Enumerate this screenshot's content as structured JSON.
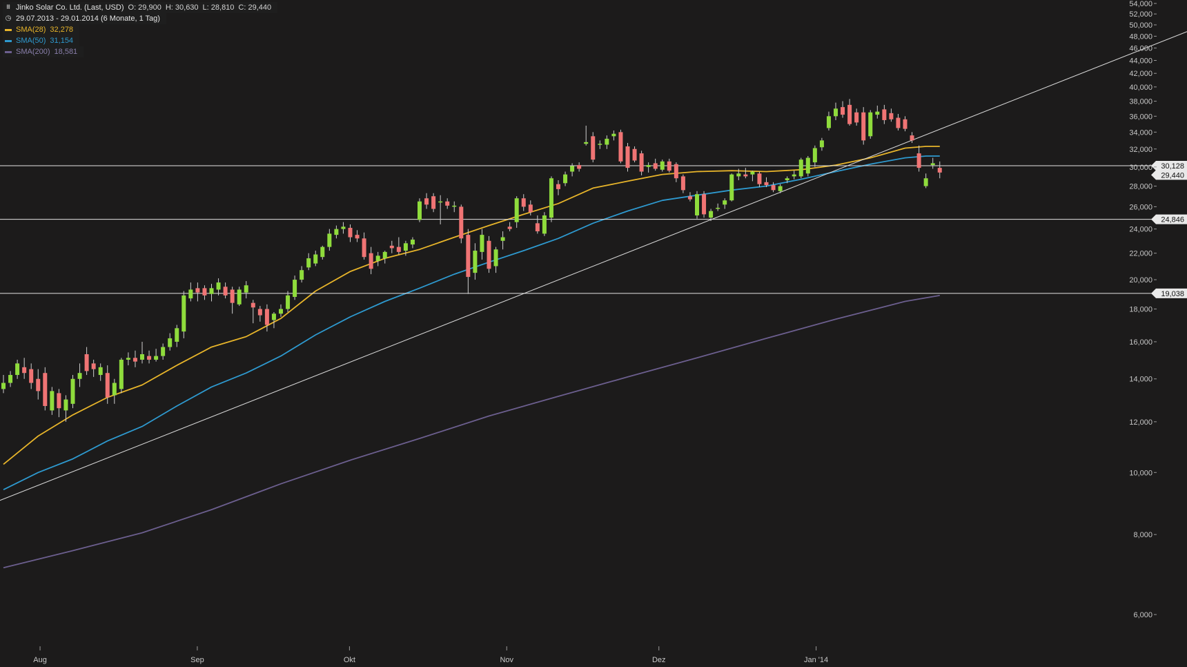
{
  "header": {
    "title": "Jinko Solar Co. Ltd. (Last, USD)",
    "open": "O: 29,900",
    "high": "H: 30,630",
    "low": "L: 28,810",
    "close": "C: 29,440",
    "period": "29.07.2013 - 29.01.2014 (6 Monate, 1 Tag)"
  },
  "indicators": [
    {
      "name": "SMA(28)",
      "value": "32,278",
      "color": "#e8b52a"
    },
    {
      "name": "SMA(50)",
      "value": "31,154",
      "color": "#2e9ad0"
    },
    {
      "name": "SMA(200)",
      "value": "18,581",
      "color": "#6c5f8f"
    }
  ],
  "colors": {
    "up": "#8fdc3c",
    "down": "#f07474",
    "background": "#1c1b1b",
    "axis_text": "#c8c8c8"
  },
  "chart_data": {
    "type": "candlestick",
    "scale": "log",
    "ylim": [
      5.3,
      54
    ],
    "yticks": [
      "6,000",
      "8,000",
      "10,000",
      "12,000",
      "14,000",
      "16,000",
      "18,000",
      "20,000",
      "22,000",
      "24,000",
      "26,000",
      "28,000",
      "30,000",
      "32,000",
      "34,000",
      "36,000",
      "38,000",
      "40,000",
      "42,000",
      "44,000",
      "46,000",
      "48,000",
      "50,000",
      "52,000",
      "54,000"
    ],
    "xticks": [
      "Aug",
      "Sep",
      "Okt",
      "Nov",
      "Dez",
      "Jan '14"
    ],
    "xtick_days": [
      3,
      34,
      64,
      95,
      125,
      156
    ],
    "candles": [
      [
        0,
        13.5,
        14.2,
        13.3,
        13.8
      ],
      [
        1,
        13.8,
        14.4,
        13.6,
        14.2
      ],
      [
        2,
        14.2,
        15.0,
        14.0,
        14.8
      ],
      [
        3,
        14.6,
        15.1,
        14.0,
        14.3
      ],
      [
        4,
        14.5,
        14.8,
        13.5,
        13.8
      ],
      [
        5,
        14.0,
        14.5,
        13.0,
        13.4
      ],
      [
        6,
        14.3,
        14.6,
        12.5,
        12.7
      ],
      [
        7,
        12.5,
        13.6,
        12.3,
        13.4
      ],
      [
        8,
        13.3,
        13.5,
        12.2,
        12.6
      ],
      [
        9,
        12.5,
        13.2,
        12.0,
        13.0
      ],
      [
        10,
        12.8,
        14.2,
        12.6,
        14.0
      ],
      [
        11,
        14.0,
        14.8,
        13.6,
        14.3
      ],
      [
        12,
        15.3,
        15.7,
        14.2,
        14.4
      ],
      [
        13,
        14.8,
        15.0,
        14.1,
        14.5
      ],
      [
        14,
        14.2,
        14.8,
        13.9,
        14.6
      ],
      [
        15,
        14.3,
        14.7,
        12.8,
        13.1
      ],
      [
        16,
        13.2,
        14.0,
        12.8,
        13.8
      ],
      [
        17,
        13.5,
        15.1,
        13.3,
        15.0
      ],
      [
        18,
        15.0,
        15.4,
        14.7,
        15.1
      ],
      [
        19,
        15.1,
        15.5,
        14.6,
        14.9
      ],
      [
        20,
        15.0,
        16.0,
        14.8,
        15.3
      ],
      [
        21,
        15.2,
        15.5,
        14.8,
        15.0
      ],
      [
        22,
        15.0,
        15.6,
        14.9,
        15.2
      ],
      [
        23,
        15.2,
        15.9,
        15.0,
        15.7
      ],
      [
        24,
        15.7,
        16.5,
        15.5,
        16.2
      ],
      [
        25,
        16.0,
        17.0,
        15.7,
        16.8
      ],
      [
        26,
        16.6,
        19.2,
        16.2,
        18.9
      ],
      [
        27,
        18.7,
        19.8,
        18.5,
        19.3
      ],
      [
        28,
        19.4,
        19.8,
        18.5,
        19.1
      ],
      [
        29,
        19.4,
        19.6,
        18.6,
        18.9
      ],
      [
        30,
        19.0,
        19.7,
        18.5,
        19.4
      ],
      [
        31,
        19.3,
        20.1,
        18.9,
        19.8
      ],
      [
        32,
        19.5,
        19.8,
        18.7,
        18.9
      ],
      [
        33,
        19.3,
        19.5,
        17.7,
        18.4
      ],
      [
        34,
        18.3,
        19.5,
        18.2,
        19.3
      ],
      [
        35,
        19.1,
        19.9,
        18.7,
        19.6
      ],
      [
        36,
        18.4,
        18.6,
        17.1,
        18.1
      ],
      [
        37,
        18.0,
        18.2,
        17.2,
        17.6
      ],
      [
        38,
        18.0,
        18.3,
        16.6,
        17.0
      ],
      [
        39,
        17.3,
        17.8,
        16.8,
        17.7
      ],
      [
        40,
        17.7,
        18.3,
        17.5,
        18.0
      ],
      [
        41,
        18.0,
        19.2,
        17.8,
        18.9
      ],
      [
        42,
        18.8,
        20.3,
        18.6,
        20.0
      ],
      [
        43,
        20.0,
        21.0,
        19.8,
        20.7
      ],
      [
        44,
        20.9,
        22.0,
        20.7,
        21.6
      ],
      [
        45,
        21.2,
        22.2,
        21.0,
        21.9
      ],
      [
        46,
        21.7,
        22.6,
        21.5,
        22.5
      ],
      [
        47,
        22.5,
        24.0,
        22.2,
        23.6
      ],
      [
        48,
        23.5,
        24.3,
        23.2,
        24.0
      ],
      [
        49,
        24.0,
        24.6,
        23.6,
        24.2
      ],
      [
        50,
        24.1,
        24.4,
        22.9,
        23.3
      ],
      [
        51,
        23.5,
        23.9,
        22.9,
        23.2
      ],
      [
        52,
        23.2,
        23.7,
        21.5,
        21.7
      ],
      [
        53,
        22.0,
        22.5,
        20.4,
        20.8
      ],
      [
        54,
        21.4,
        22.1,
        21.0,
        21.8
      ],
      [
        55,
        21.6,
        22.2,
        21.2,
        22.1
      ],
      [
        56,
        22.6,
        23.0,
        22.0,
        22.4
      ],
      [
        57,
        22.5,
        23.3,
        21.9,
        22.1
      ],
      [
        58,
        22.2,
        23.0,
        21.8,
        22.8
      ],
      [
        59,
        22.7,
        23.3,
        22.4,
        23.1
      ],
      [
        60,
        24.8,
        26.8,
        24.6,
        26.5
      ],
      [
        61,
        26.8,
        27.3,
        25.8,
        26.2
      ],
      [
        62,
        27.0,
        27.3,
        25.5,
        25.8
      ],
      [
        63,
        26.5,
        27.1,
        24.4,
        26.5
      ],
      [
        64,
        26.5,
        26.8,
        25.8,
        26.1
      ],
      [
        65,
        26.0,
        26.5,
        25.5,
        26.1
      ],
      [
        66,
        26.0,
        26.2,
        22.8,
        23.2
      ],
      [
        67,
        23.5,
        24.0,
        19.0,
        20.2
      ],
      [
        68,
        20.5,
        22.8,
        20.0,
        22.2
      ],
      [
        69,
        22.1,
        24.0,
        21.5,
        23.5
      ],
      [
        70,
        23.0,
        23.4,
        20.5,
        20.8
      ],
      [
        71,
        21.0,
        22.5,
        20.5,
        22.3
      ],
      [
        72,
        23.0,
        23.8,
        22.3,
        23.3
      ],
      [
        73,
        24.2,
        24.6,
        23.8,
        24.0
      ],
      [
        74,
        24.6,
        27.0,
        24.1,
        26.8
      ],
      [
        75,
        26.8,
        27.2,
        25.6,
        26.0
      ],
      [
        76,
        26.2,
        26.6,
        25.2,
        25.5
      ],
      [
        77,
        24.5,
        25.2,
        23.6,
        23.8
      ],
      [
        78,
        23.6,
        25.5,
        23.4,
        25.2
      ],
      [
        79,
        25.0,
        29.0,
        24.6,
        28.8
      ],
      [
        80,
        28.2,
        28.6,
        27.1,
        27.7
      ],
      [
        81,
        28.3,
        29.5,
        28.0,
        29.2
      ],
      [
        82,
        29.5,
        30.4,
        29.0,
        30.1
      ],
      [
        83,
        30.2,
        30.5,
        29.5,
        29.8
      ],
      [
        84,
        32.6,
        34.8,
        32.4,
        32.8
      ],
      [
        85,
        33.5,
        34.0,
        30.5,
        30.8
      ],
      [
        86,
        32.5,
        33.0,
        32.0,
        32.6
      ],
      [
        87,
        32.5,
        33.6,
        32.0,
        33.2
      ],
      [
        88,
        33.5,
        34.2,
        33.0,
        33.8
      ],
      [
        89,
        34.0,
        34.3,
        30.4,
        30.6
      ],
      [
        90,
        32.3,
        32.7,
        29.5,
        29.9
      ],
      [
        91,
        32.0,
        32.3,
        30.5,
        30.7
      ],
      [
        92,
        31.5,
        31.8,
        29.1,
        29.5
      ],
      [
        93,
        30.0,
        30.5,
        29.4,
        30.2
      ],
      [
        94,
        30.4,
        30.9,
        29.6,
        29.8
      ],
      [
        95,
        29.7,
        30.8,
        29.5,
        30.6
      ],
      [
        96,
        30.6,
        30.9,
        29.4,
        29.6
      ],
      [
        97,
        30.3,
        30.5,
        28.4,
        28.8
      ],
      [
        98,
        29.0,
        29.2,
        27.3,
        27.6
      ],
      [
        99,
        27.0,
        27.4,
        26.5,
        26.7
      ],
      [
        100,
        25.2,
        27.5,
        24.9,
        27.2
      ],
      [
        101,
        27.2,
        27.5,
        25.0,
        25.3
      ],
      [
        102,
        25.0,
        25.8,
        24.7,
        25.6
      ],
      [
        103,
        25.9,
        26.3,
        25.6,
        25.9
      ],
      [
        104,
        26.2,
        26.8,
        25.8,
        26.6
      ],
      [
        105,
        26.6,
        29.3,
        26.5,
        29.2
      ],
      [
        106,
        29.0,
        29.8,
        28.6,
        29.3
      ],
      [
        107,
        29.2,
        29.9,
        28.8,
        29.0
      ],
      [
        108,
        29.2,
        29.6,
        28.5,
        29.5
      ],
      [
        109,
        29.3,
        29.5,
        27.9,
        28.2
      ],
      [
        110,
        28.4,
        28.9,
        27.9,
        28.1
      ],
      [
        111,
        28.1,
        28.4,
        27.4,
        27.6
      ],
      [
        112,
        27.5,
        28.2,
        27.3,
        28.0
      ],
      [
        113,
        28.6,
        29.0,
        28.3,
        28.8
      ],
      [
        114,
        29.0,
        29.6,
        28.7,
        29.2
      ],
      [
        115,
        29.0,
        31.0,
        28.8,
        30.8
      ],
      [
        116,
        29.3,
        31.2,
        29.0,
        31.0
      ],
      [
        117,
        30.5,
        32.4,
        30.0,
        32.1
      ],
      [
        118,
        32.2,
        33.3,
        31.8,
        33.0
      ],
      [
        119,
        34.5,
        36.6,
        34.2,
        36.0
      ],
      [
        120,
        36.0,
        37.8,
        35.5,
        37.0
      ],
      [
        121,
        37.2,
        38.0,
        35.8,
        36.2
      ],
      [
        122,
        37.5,
        38.3,
        34.8,
        35.0
      ],
      [
        123,
        36.5,
        37.0,
        34.8,
        35.2
      ],
      [
        124,
        36.5,
        37.2,
        32.5,
        33.0
      ],
      [
        125,
        33.5,
        36.8,
        33.2,
        36.5
      ],
      [
        126,
        36.2,
        37.4,
        35.7,
        36.6
      ],
      [
        127,
        36.9,
        37.5,
        35.0,
        35.5
      ],
      [
        128,
        36.4,
        37.0,
        35.3,
        35.6
      ],
      [
        129,
        35.8,
        36.3,
        34.2,
        34.5
      ],
      [
        130,
        35.6,
        36.0,
        34.1,
        34.4
      ],
      [
        131,
        33.6,
        34.0,
        32.7,
        33.0
      ],
      [
        132,
        31.5,
        32.4,
        29.5,
        29.9
      ],
      [
        133,
        28.0,
        29.3,
        27.8,
        28.8
      ],
      [
        134,
        30.2,
        31.0,
        29.8,
        30.4
      ],
      [
        135,
        29.9,
        30.6,
        28.8,
        29.4
      ]
    ],
    "sma": [
      {
        "name": "SMA(28)",
        "color": "#e8b52a",
        "points": [
          [
            0,
            10.3
          ],
          [
            5,
            11.4
          ],
          [
            10,
            12.3
          ],
          [
            15,
            13.1
          ],
          [
            20,
            13.7
          ],
          [
            25,
            14.7
          ],
          [
            30,
            15.7
          ],
          [
            35,
            16.3
          ],
          [
            40,
            17.4
          ],
          [
            45,
            19.2
          ],
          [
            50,
            20.6
          ],
          [
            55,
            21.6
          ],
          [
            60,
            22.3
          ],
          [
            65,
            23.3
          ],
          [
            70,
            24.3
          ],
          [
            75,
            25.3
          ],
          [
            80,
            26.3
          ],
          [
            85,
            27.8
          ],
          [
            90,
            28.5
          ],
          [
            95,
            29.2
          ],
          [
            100,
            29.5
          ],
          [
            105,
            29.6
          ],
          [
            110,
            29.5
          ],
          [
            115,
            29.7
          ],
          [
            120,
            30.2
          ],
          [
            125,
            31.0
          ],
          [
            130,
            32.1
          ],
          [
            133,
            32.3
          ],
          [
            135,
            32.3
          ]
        ]
      },
      {
        "name": "SMA(50)",
        "color": "#2e9ad0",
        "points": [
          [
            0,
            9.4
          ],
          [
            5,
            10.0
          ],
          [
            10,
            10.5
          ],
          [
            15,
            11.2
          ],
          [
            20,
            11.8
          ],
          [
            25,
            12.7
          ],
          [
            30,
            13.6
          ],
          [
            35,
            14.3
          ],
          [
            40,
            15.2
          ],
          [
            45,
            16.4
          ],
          [
            50,
            17.5
          ],
          [
            55,
            18.5
          ],
          [
            60,
            19.4
          ],
          [
            65,
            20.4
          ],
          [
            70,
            21.3
          ],
          [
            75,
            22.2
          ],
          [
            80,
            23.2
          ],
          [
            85,
            24.5
          ],
          [
            90,
            25.6
          ],
          [
            95,
            26.6
          ],
          [
            100,
            27.1
          ],
          [
            105,
            27.6
          ],
          [
            110,
            28.0
          ],
          [
            115,
            28.7
          ],
          [
            120,
            29.5
          ],
          [
            125,
            30.3
          ],
          [
            130,
            31.0
          ],
          [
            133,
            31.2
          ],
          [
            135,
            31.2
          ]
        ]
      },
      {
        "name": "SMA(200)",
        "color": "#6c5f8f",
        "points": [
          [
            0,
            7.1
          ],
          [
            10,
            7.55
          ],
          [
            20,
            8.05
          ],
          [
            30,
            8.75
          ],
          [
            40,
            9.6
          ],
          [
            50,
            10.45
          ],
          [
            60,
            11.3
          ],
          [
            70,
            12.25
          ],
          [
            80,
            13.15
          ],
          [
            90,
            14.1
          ],
          [
            100,
            15.1
          ],
          [
            110,
            16.2
          ],
          [
            120,
            17.35
          ],
          [
            130,
            18.5
          ],
          [
            135,
            18.9
          ]
        ]
      }
    ],
    "horizontal_lines": [
      {
        "value": 30.128,
        "label": "30,128"
      },
      {
        "value": 24.846,
        "label": "24,846"
      },
      {
        "value": 19.038,
        "label": "19,038"
      }
    ],
    "trendline": {
      "from": [
        -1,
        9.0
      ],
      "to": [
        180,
        53.5
      ]
    },
    "last_price_label": "29,440"
  }
}
